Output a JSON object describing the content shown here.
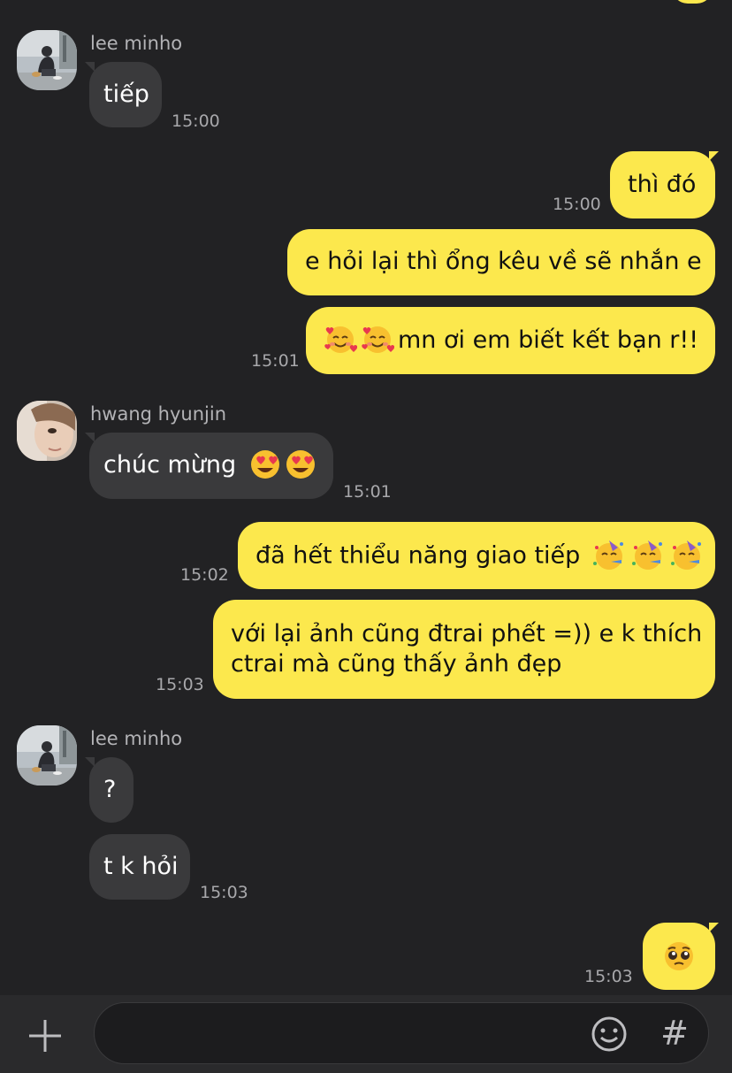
{
  "app": {
    "name": "KakaoTalk chat",
    "colors": {
      "background": "#222224",
      "incoming_bubble": "#3A3A3C",
      "outgoing_bubble": "#FCE84D",
      "timestamp": "#A8A8AB",
      "sender_name": "#B3B3B6"
    }
  },
  "messages": {
    "m1": {
      "sender": "lee minho",
      "text": "tiếp",
      "time": "15:00"
    },
    "m2": {
      "text": "thì đó",
      "time": "15:00"
    },
    "m3": {
      "text": "e hỏi lại thì ổng kêu về sẽ nhắn e"
    },
    "m4": {
      "emoji": "smiling-face-with-hearts-icon",
      "text": "mn ơi em biết kết bạn r!!",
      "time": "15:01"
    },
    "m5": {
      "sender": "hwang hyunjin",
      "text": "chúc mừng",
      "emoji": "heart-eyes-icon",
      "time": "15:01"
    },
    "m6": {
      "text": "đã hết thiểu năng giao tiếp",
      "emoji": "partying-face-icon",
      "time": "15:02"
    },
    "m7": {
      "line1": "với lại ảnh cũng đtrai phết =)) e k thích",
      "line2": "ctrai mà cũng thấy ảnh đẹp",
      "time": "15:03"
    },
    "m8": {
      "sender": "lee minho",
      "text": "?"
    },
    "m9": {
      "text": "t k hỏi",
      "time": "15:03"
    },
    "m10": {
      "emoji": "pleading-face-icon",
      "time": "15:03"
    }
  },
  "input_bar": {
    "placeholder": "",
    "value": "",
    "add_icon": "plus-icon",
    "emoji_icon": "smiley-icon",
    "hashtag_label": "#"
  }
}
